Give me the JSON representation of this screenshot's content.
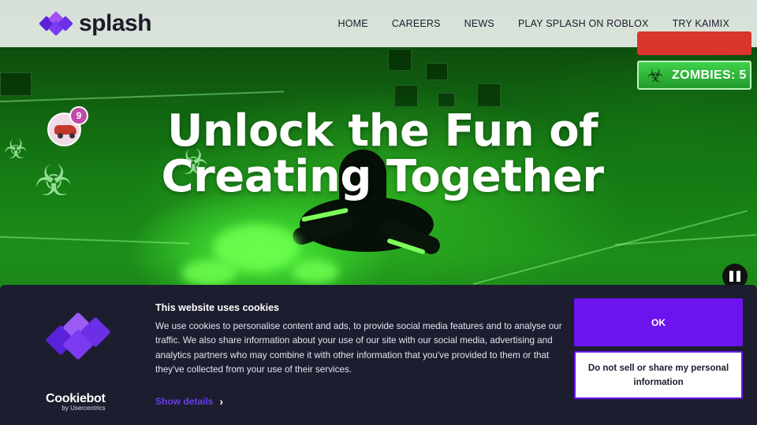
{
  "brand": {
    "name": "splash",
    "accent": "#6c14ee",
    "logo_colors": [
      "#7b3cf0",
      "#a24ff5",
      "#5a22d8"
    ]
  },
  "nav": {
    "items": [
      "HOME",
      "CAREERS",
      "NEWS",
      "PLAY SPLASH ON ROBLOX",
      "TRY KAIMIX"
    ]
  },
  "hero": {
    "headline": "Unlock the Fun of Creating Together",
    "avatar_badge_count": "9",
    "hud": {
      "zombies_label": "ZOMBIES: 5",
      "zombies_icon": "biohazard-icon"
    },
    "video_control": "pause-icon"
  },
  "cookie_banner": {
    "title": "This website uses cookies",
    "body": "We use cookies to personalise content and ads, to provide social media features and to analyse our traffic. We also share information about your use of our site with our social media, advertising and analytics partners who may combine it with other information that you've provided to them or that they've collected from your use of their services.",
    "show_details": "Show details",
    "ok_label": "OK",
    "do_not_sell_label": "Do not sell or share my personal information",
    "provider": "Cookiebot",
    "provider_sub": "by Usercentrics"
  }
}
